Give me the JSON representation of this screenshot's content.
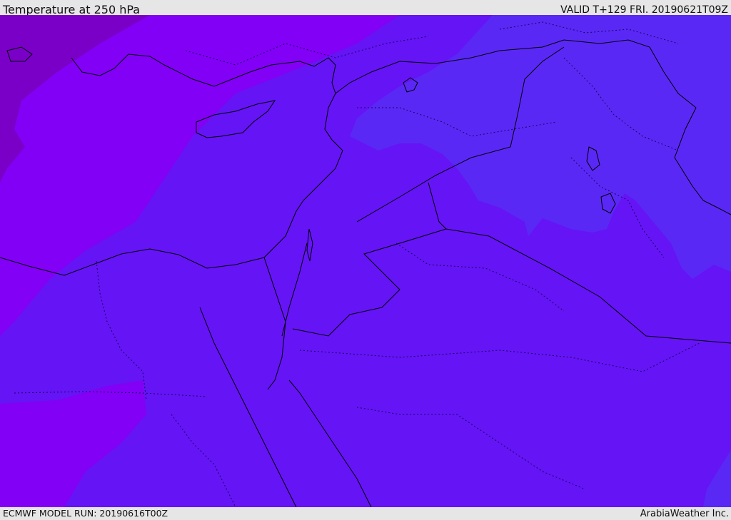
{
  "header": {
    "title": "Temperature at 250 hPa",
    "valid": "VALID T+129 FRI. 20190621T09Z"
  },
  "footer": {
    "model_run": "ECMWF MODEL RUN: 20190616T00Z",
    "brand": "ArabiaWeather Inc."
  },
  "map": {
    "colors": {
      "deep_violet": "#7a00c8",
      "violet": "#8200f5",
      "indigo": "#6514f5",
      "blue_violet": "#5a28f5",
      "border": "#000000"
    }
  }
}
